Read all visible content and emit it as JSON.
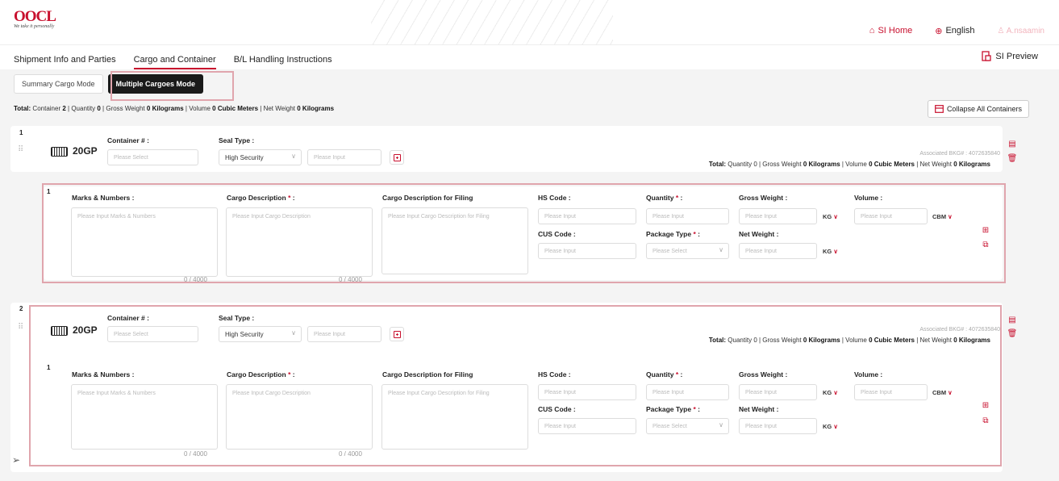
{
  "header": {
    "logo": "OOCL",
    "tagline": "We take it personally",
    "si_home": "SI Home",
    "language": "English",
    "user": "A.nsaamin"
  },
  "tabs": [
    "Shipment Info and Parties",
    "Cargo and Container",
    "B/L Handling Instructions"
  ],
  "si_preview": "SI Preview",
  "modes": [
    "Summary Cargo Mode",
    "Multiple Cargoes Mode"
  ],
  "totals": {
    "label": "Total:",
    "container_label": "Container",
    "container": "2",
    "quantity_label": "Quantity",
    "quantity": "0",
    "gross_label": "Gross Weight",
    "gross": "0 Kilograms",
    "volume_label": "Volume",
    "volume": "0 Cubic Meters",
    "net_label": "Net Weight",
    "net": "0 Kilograms"
  },
  "collapse_label": "Collapse All Containers",
  "containers": [
    {
      "index": "1",
      "type": "20GP",
      "container_label": "Container # :",
      "container_ph": "Please Select",
      "seal_label": "Seal Type :",
      "seal_value": "High Security",
      "seal_ph": "Please Input",
      "assoc": "Associated BKG# : 4072635840",
      "tot": {
        "label": "Total:",
        "q": "Quantity 0",
        "g_pre": "Gross Weight",
        "g": "0 Kilograms",
        "v_pre": "Volume",
        "v": "0 Cubic Meters",
        "n_pre": "Net Weight",
        "n": "0 Kilograms"
      },
      "cargo": {
        "index": "1",
        "marks_label": "Marks & Numbers :",
        "marks_ph": "Please Input  Marks & Numbers",
        "desc_label": "Cargo Description",
        "desc_ph": "Please Input  Cargo Description",
        "filing_label": "Cargo Description for Filing",
        "filing_ph": "Please Input  Cargo Description for Filing",
        "count": "0 / 4000",
        "hs_label": "HS Code :",
        "hs_ph": "Please Input",
        "cus_label": "CUS Code :",
        "cus_ph": "Please Input",
        "qty_label": "Quantity",
        "qty_ph": "Please Input",
        "pkg_label": "Package Type",
        "pkg_ph": "Please Select",
        "gw_label": "Gross Weight :",
        "gw_ph": "Please Input",
        "nw_label": "Net Weight :",
        "nw_ph": "Please Input",
        "kg": "KG",
        "vol_label": "Volume :",
        "vol_ph": "Please Input",
        "cbm": "CBM"
      }
    },
    {
      "index": "2",
      "type": "20GP",
      "container_label": "Container # :",
      "container_ph": "Please Select",
      "seal_label": "Seal Type :",
      "seal_value": "High Security",
      "seal_ph": "Please Input",
      "assoc": "Associated BKG# : 4072635840",
      "tot": {
        "label": "Total:",
        "q": "Quantity 0",
        "g_pre": "Gross Weight",
        "g": "0 Kilograms",
        "v_pre": "Volume",
        "v": "0 Cubic Meters",
        "n_pre": "Net Weight",
        "n": "0 Kilograms"
      },
      "cargo": {
        "index": "1",
        "marks_label": "Marks & Numbers :",
        "marks_ph": "Please Input  Marks & Numbers",
        "desc_label": "Cargo Description",
        "desc_ph": "Please Input  Cargo Description",
        "filing_label": "Cargo Description for Filing",
        "filing_ph": "Please Input  Cargo Description for Filing",
        "count": "0 / 4000",
        "hs_label": "HS Code :",
        "hs_ph": "Please Input",
        "cus_label": "CUS Code :",
        "cus_ph": "Please Input",
        "qty_label": "Quantity",
        "qty_ph": "Please Input",
        "pkg_label": "Package Type",
        "pkg_ph": "Please Select",
        "gw_label": "Gross Weight :",
        "gw_ph": "Please Input",
        "nw_label": "Net Weight :",
        "nw_ph": "Please Input",
        "kg": "KG",
        "vol_label": "Volume :",
        "vol_ph": "Please Input",
        "cbm": "CBM"
      }
    }
  ],
  "colors": {
    "accent": "#c8102e",
    "highlight": "#e0a5ad"
  }
}
